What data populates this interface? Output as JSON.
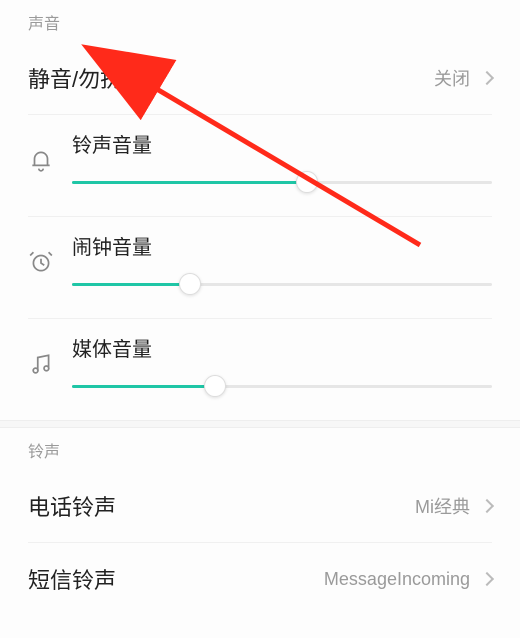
{
  "sections": {
    "sound_header": "声音",
    "ringtone_header": "铃声"
  },
  "dnd": {
    "title": "静音/勿扰",
    "value": "关闭"
  },
  "sliders": {
    "ringtone": {
      "label": "铃声音量",
      "percent": 56
    },
    "alarm": {
      "label": "闹钟音量",
      "percent": 28
    },
    "media": {
      "label": "媒体音量",
      "percent": 34
    }
  },
  "ringtones": {
    "phone": {
      "label": "电话铃声",
      "value": "Mi经典"
    },
    "sms": {
      "label": "短信铃声",
      "value": "MessageIncoming"
    }
  },
  "colors": {
    "accent": "#1fc6a6",
    "annotation": "#ff2a1a"
  }
}
